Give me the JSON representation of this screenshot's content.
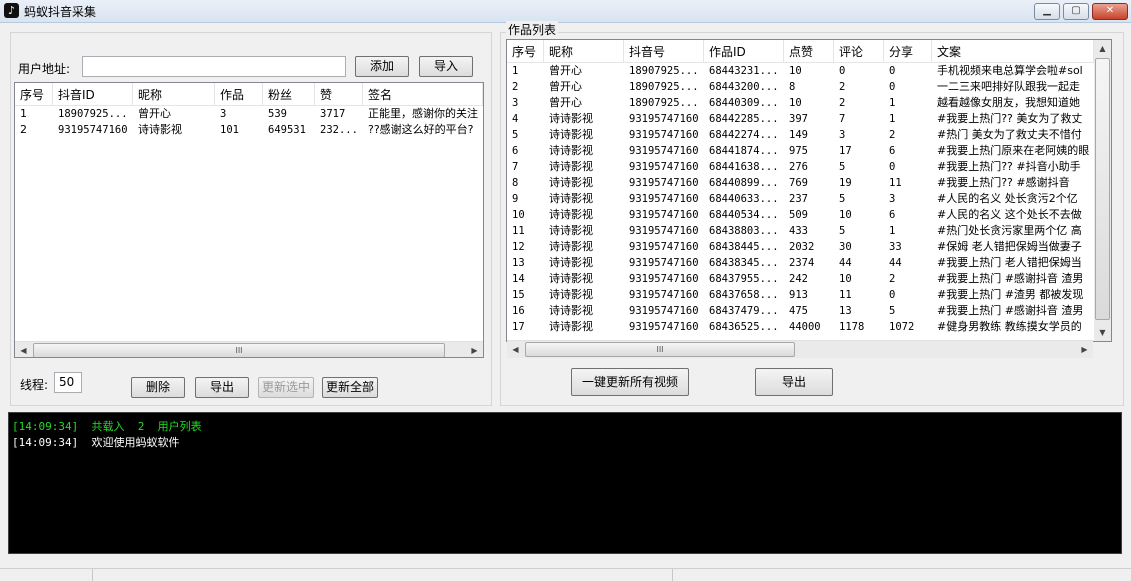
{
  "window": {
    "title": "蚂蚁抖音采集",
    "icon": "tiktok-icon",
    "min": "▁",
    "max": "▢",
    "close": "✕"
  },
  "users_panel": {
    "address_label": "用户地址:",
    "address_value": "",
    "add_button": "添加",
    "import_button": "导入",
    "columns": [
      "序号",
      "抖音ID",
      "昵称",
      "作品",
      "粉丝",
      "赞",
      "签名"
    ],
    "rows": [
      [
        "1",
        "18907925...",
        "曾开心",
        "3",
        "539",
        "3717",
        "正能里，感谢你的关注"
      ],
      [
        "2",
        "93195747160",
        "诗诗影视",
        "101",
        "649531",
        "232...",
        "??感谢这么好的平台?"
      ]
    ],
    "threads_label": "线程:",
    "threads_value": "50",
    "delete_button": "删除",
    "export_button": "导出",
    "update_selected_button": "更新选中",
    "update_all_button": "更新全部"
  },
  "works_panel": {
    "title": "作品列表",
    "columns": [
      "序号",
      "昵称",
      "抖音号",
      "作品ID",
      "点赞",
      "评论",
      "分享",
      "文案"
    ],
    "rows": [
      [
        "1",
        "曾开心",
        "18907925...",
        "68443231...",
        "10",
        "0",
        "0",
        "手机视频来电总算学会啦#sol"
      ],
      [
        "2",
        "曾开心",
        "18907925...",
        "68443200...",
        "8",
        "2",
        "0",
        "一二三来吧排好队跟我一起走"
      ],
      [
        "3",
        "曾开心",
        "18907925...",
        "68440309...",
        "10",
        "2",
        "1",
        "越看越像女朋友，我想知道她"
      ],
      [
        "4",
        "诗诗影视",
        "93195747160",
        "68442285...",
        "397",
        "7",
        "1",
        "#我要上热门?? 美女为了救丈"
      ],
      [
        "5",
        "诗诗影视",
        "93195747160",
        "68442274...",
        "149",
        "3",
        "2",
        "#热门 美女为了救丈夫不惜付"
      ],
      [
        "6",
        "诗诗影视",
        "93195747160",
        "68441874...",
        "975",
        "17",
        "6",
        "#我要上热门原来在老阿姨的眼"
      ],
      [
        "7",
        "诗诗影视",
        "93195747160",
        "68441638...",
        "276",
        "5",
        "0",
        "#我要上热门??  #抖音小助手"
      ],
      [
        "8",
        "诗诗影视",
        "93195747160",
        "68440899...",
        "769",
        "19",
        "11",
        "#我要上热门??  #感谢抖音"
      ],
      [
        "9",
        "诗诗影视",
        "93195747160",
        "68440633...",
        "237",
        "5",
        "3",
        "#人民的名义 处长贪污2个亿"
      ],
      [
        "10",
        "诗诗影视",
        "93195747160",
        "68440534...",
        "509",
        "10",
        "6",
        "#人民的名义  这个处长不去做"
      ],
      [
        "11",
        "诗诗影视",
        "93195747160",
        "68438803...",
        "433",
        "5",
        "1",
        "#热门处长贪污家里两个亿 高"
      ],
      [
        "12",
        "诗诗影视",
        "93195747160",
        "68438445...",
        "2032",
        "30",
        "33",
        "#保姆 老人错把保姆当做妻子"
      ],
      [
        "13",
        "诗诗影视",
        "93195747160",
        "68438345...",
        "2374",
        "44",
        "44",
        "#我要上热门 老人错把保姆当"
      ],
      [
        "14",
        "诗诗影视",
        "93195747160",
        "68437955...",
        "242",
        "10",
        "2",
        "#我要上热门  #感谢抖音 渣男"
      ],
      [
        "15",
        "诗诗影视",
        "93195747160",
        "68437658...",
        "913",
        "11",
        "0",
        "#我要上热门  #渣男 都被发现"
      ],
      [
        "16",
        "诗诗影视",
        "93195747160",
        "68437479...",
        "475",
        "13",
        "5",
        "#我要上热门 #感谢抖音 渣男"
      ],
      [
        "17",
        "诗诗影视",
        "93195747160",
        "68436525...",
        "44000",
        "1178",
        "1072",
        "#健身男教练 教练摸女学员的"
      ]
    ],
    "update_all_videos_button": "一键更新所有视频",
    "export_button": "导出"
  },
  "scrollbar": {
    "left_arrow": "◀",
    "right_arrow": "▶",
    "up_arrow": "▲",
    "down_arrow": "▼",
    "grip": "III"
  },
  "log": {
    "lines": [
      {
        "text": "[14:09:34]  共载入  2  用户列表",
        "color": "#22dd22"
      },
      {
        "text": "[14:09:34]  欢迎使用蚂蚁软件",
        "color": "#ffffff"
      }
    ]
  }
}
